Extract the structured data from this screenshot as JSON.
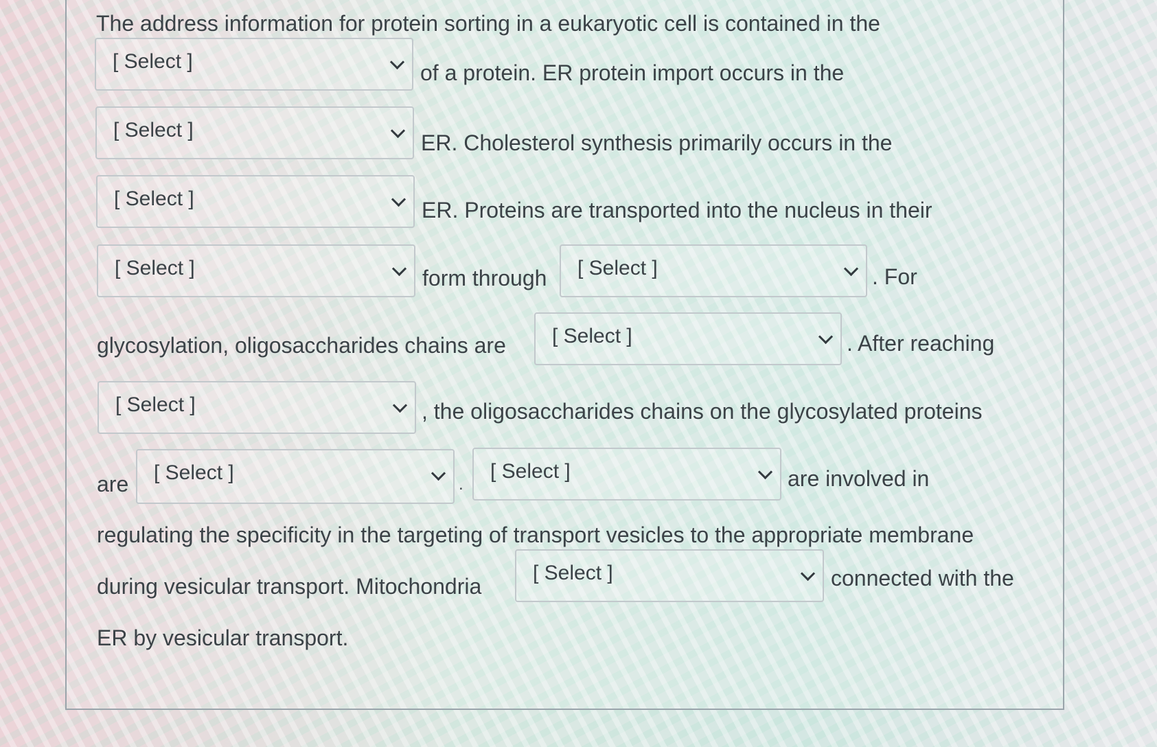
{
  "question": {
    "line1": "The address information for protein sorting in a eukaryotic cell is contained in the",
    "after_select_1": "of a protein. ER protein import occurs in the",
    "after_select_2": "ER. Cholesterol synthesis primarily occurs in the",
    "after_select_3": "ER.  Proteins are transported into the nucleus in their",
    "after_select_4": "form through",
    "after_select_5": ". For",
    "before_select_6": "glycosylation, oligosaccharides chains are",
    "after_select_6": ". After reaching",
    "after_select_7": ", the oligosaccharides chains on the glycosylated proteins",
    "before_select_8": "are",
    "after_select_8": ".",
    "after_select_9": "are involved in",
    "line_regulating": "regulating the specificity in the targeting of transport vesicles to the appropriate membrane",
    "before_select_10": "during vesicular transport. Mitochondria",
    "after_select_10": "connected with the",
    "last_line": "ER by vesicular transport."
  },
  "dropdowns": {
    "placeholder": "[ Select ]",
    "selects": [
      {
        "value": "[ Select ]"
      },
      {
        "value": "[ Select ]"
      },
      {
        "value": "[ Select ]"
      },
      {
        "value": "[ Select ]"
      },
      {
        "value": "[ Select ]"
      },
      {
        "value": "[ Select ]"
      },
      {
        "value": "[ Select ]"
      },
      {
        "value": "[ Select ]"
      },
      {
        "value": "[ Select ]"
      },
      {
        "value": "[ Select ]"
      }
    ]
  },
  "icons": {
    "dropdown_arrow": "chevron-down-icon"
  }
}
